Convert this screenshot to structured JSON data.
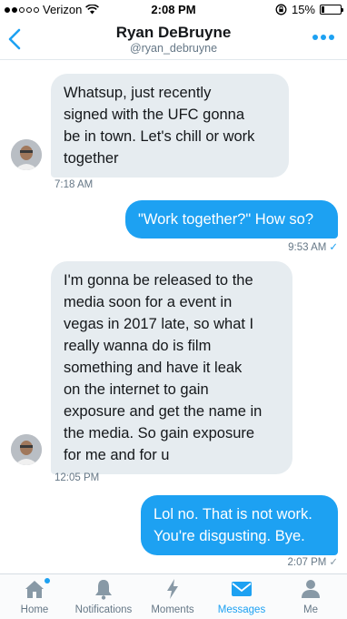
{
  "status": {
    "carrier": "Verizon",
    "time": "2:08 PM",
    "battery": "15%",
    "battery_level": 0.15
  },
  "header": {
    "name": "Ryan DeBruyne",
    "handle": "@ryan_debruyne"
  },
  "messages": [
    {
      "direction": "in",
      "lines": [
        "Whatsup, just recently",
        "signed with the UFC gonna",
        "be in town. Let's chill or work",
        "together"
      ],
      "time": "7:18 AM"
    },
    {
      "direction": "out",
      "lines": [
        "\"Work together?\" How so?"
      ],
      "time": "9:53 AM",
      "status_mark": "✓"
    },
    {
      "direction": "in",
      "lines": [
        "I'm gonna be released to the",
        "media soon for a event in",
        "vegas in 2017 late, so what I",
        "really wanna do is film",
        "something and have it leak",
        "on the internet to gain",
        "exposure and get the name in",
        "the media. So gain exposure",
        "for me and for u"
      ],
      "time": "12:05 PM"
    },
    {
      "direction": "out",
      "lines": [
        "Lol no. That is not work.",
        "You're disgusting. Bye."
      ],
      "time": "2:07 PM",
      "status_mark": "✓"
    }
  ],
  "tabs": [
    {
      "label": "Home",
      "icon": "home-icon",
      "active": false,
      "badge": true
    },
    {
      "label": "Notifications",
      "icon": "bell-icon",
      "active": false,
      "badge": false
    },
    {
      "label": "Moments",
      "icon": "lightning-icon",
      "active": false,
      "badge": false
    },
    {
      "label": "Messages",
      "icon": "envelope-icon",
      "active": true,
      "badge": false
    },
    {
      "label": "Me",
      "icon": "person-icon",
      "active": false,
      "badge": false
    }
  ],
  "colors": {
    "accent": "#1da1f2",
    "incoming_bubble": "#e6ecf0",
    "secondary_text": "#657786",
    "tab_icon": "#8899a6"
  }
}
